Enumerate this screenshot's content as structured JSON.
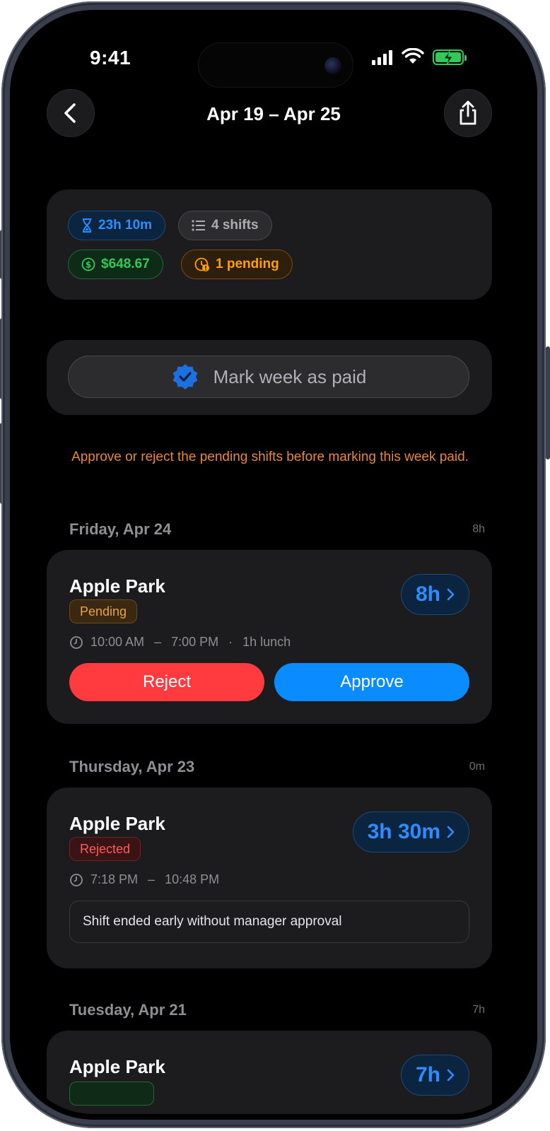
{
  "status_bar": {
    "time": "9:41"
  },
  "nav": {
    "title": "Apr 19 – Apr 25",
    "back_icon": "chevron-left-icon",
    "share_icon": "share-icon"
  },
  "summary": {
    "total_time": "23h 10m",
    "shift_count": "4 shifts",
    "earnings": "$648.67",
    "pending": "1 pending"
  },
  "actions": {
    "mark_paid_label": "Mark week as paid"
  },
  "warning": "Approve or reject the pending shifts before marking this week paid.",
  "colors": {
    "accent_blue": "#2d8cff",
    "reject_red": "#ff3b30",
    "approve_blue": "#0a84ff",
    "pending_orange": "#ff9f0a",
    "green": "#34c759"
  },
  "days": [
    {
      "label": "Friday, Apr 24",
      "total": "8h",
      "shift": {
        "location": "Apple Park",
        "status": "Pending",
        "hours": "8h",
        "start": "10:00 AM",
        "dash": "–",
        "end": "7:00 PM",
        "sep": "·",
        "lunch": "1h lunch",
        "reject_label": "Reject",
        "approve_label": "Approve"
      }
    },
    {
      "label": "Thursday, Apr 23",
      "total": "0m",
      "shift": {
        "location": "Apple Park",
        "status": "Rejected",
        "hours": "3h 30m",
        "start": "7:18 PM",
        "dash": "–",
        "end": "10:48 PM",
        "note": "Shift ended early without manager approval"
      }
    },
    {
      "label": "Tuesday, Apr 21",
      "total": "7h",
      "shift": {
        "location": "Apple Park",
        "hours": "7h"
      }
    }
  ]
}
